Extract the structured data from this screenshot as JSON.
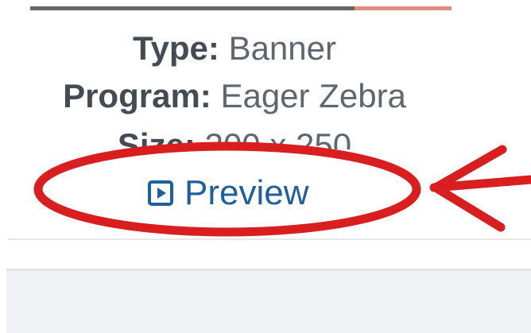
{
  "card": {
    "progress": 0.77,
    "type_label": "Type:",
    "type_value": "Banner",
    "program_label": "Program:",
    "program_value": "Eager Zebra",
    "size_label": "Size:",
    "size_value": "300 x 250",
    "preview_label": "Preview",
    "preview_icon": "play-square-icon"
  },
  "annotation": {
    "shapes": [
      "ellipse",
      "arrow"
    ],
    "color": "#d81e1e"
  },
  "colors": {
    "link": "#1e5f9e",
    "progress_fill": "#65656a",
    "progress_track": "#e6897e"
  }
}
